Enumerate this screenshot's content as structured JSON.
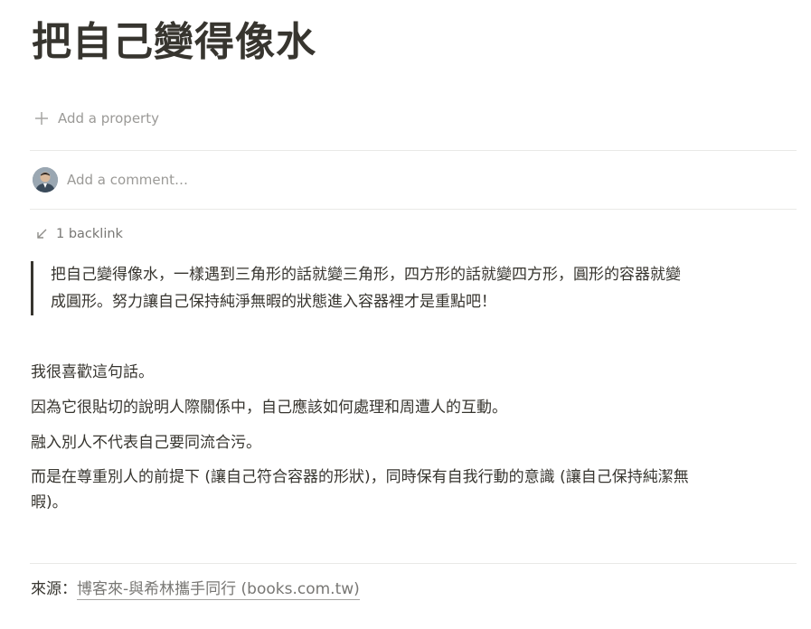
{
  "page": {
    "title": "把自己變得像水"
  },
  "properties": {
    "add_label": "Add a property",
    "add_icon": "plus-icon"
  },
  "comment": {
    "placeholder": "Add a comment…",
    "avatar_icon": "user-avatar"
  },
  "backlinks": {
    "label": "1 backlink",
    "icon": "arrow-down-left-icon"
  },
  "quote": {
    "line1": "把自己變得像水，一樣遇到三角形的話就變三角形，四方形的話就變四方形，圓形的容器就變",
    "line2": "成圓形。努力讓自己保持純淨無暇的狀態進入容器裡才是重點吧！"
  },
  "body": {
    "p1": "我很喜歡這句話。",
    "p2": "因為它很貼切的說明人際關係中，自己應該如何處理和周遭人的互動。",
    "p3": "融入別人不代表自己要同流合污。",
    "p4_line1": "而是在尊重別人的前提下 (讓自己符合容器的形狀)，同時保有自我行動的意識 (讓自己保持純潔無",
    "p4_line2": "暇)。"
  },
  "source": {
    "prefix": "來源：",
    "link_text": "博客來-與希林攜手同行 (books.com.tw)"
  },
  "colors": {
    "text": "#37352f",
    "muted": "#9b9a97",
    "divider": "#e9e9e7"
  }
}
